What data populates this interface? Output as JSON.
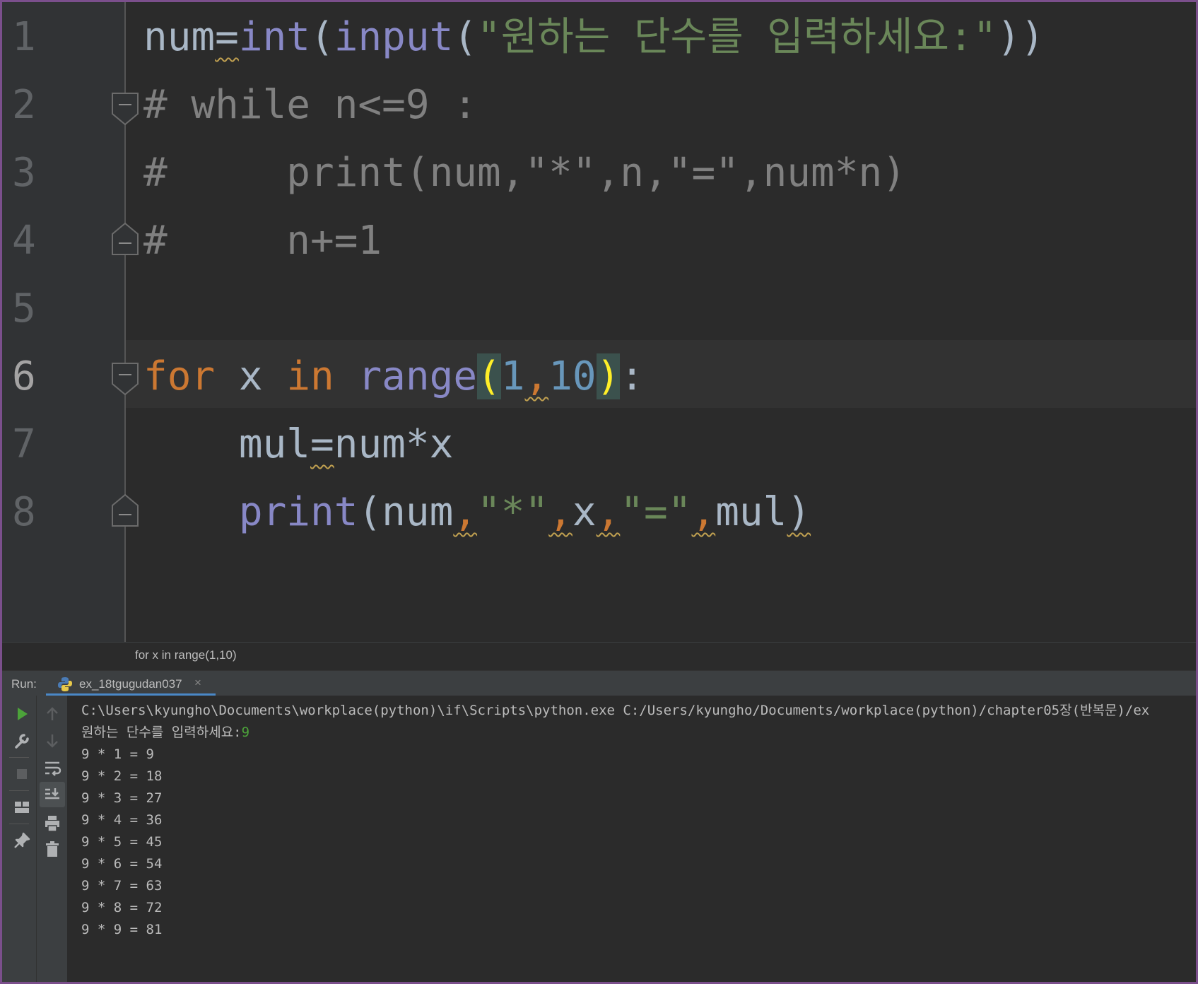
{
  "editor": {
    "line_numbers": [
      "1",
      "2",
      "3",
      "4",
      "5",
      "6",
      "7",
      "8"
    ],
    "line1": {
      "var": "num",
      "op": "=",
      "fn1": "int",
      "p1": "(",
      "fn2": "input",
      "p2": "(",
      "str": "\"원하는 단수를 입력하세요:\"",
      "p3": "))"
    },
    "line2": "# while n<=9 :",
    "line3": "#     print(num,\"*\",n,\"=\",num*n)",
    "line4": "#     n+=1",
    "line6": {
      "kw_for": "for",
      "var": " x ",
      "kw_in": "in",
      "sp": " ",
      "fn": "range",
      "open": "(",
      "a": "1",
      "comma": ",",
      "b": "10",
      "close": ")",
      "colon": ":"
    },
    "line7": {
      "indent": "    ",
      "var": "mul",
      "op": "=",
      "expr": "num*x"
    },
    "line8": {
      "indent": "    ",
      "fn": "print",
      "open": "(",
      "a": "num",
      "c1": ",",
      "s1": "\"*\"",
      "c2": ",",
      "x": "x",
      "c3": ",",
      "s2": "\"=\"",
      "c4": ",",
      "m": "mul",
      "close": ")"
    }
  },
  "breadcrumb": "for x in range(1,10)",
  "run_panel": {
    "label": "Run:",
    "tab_label": "ex_18tgugudan037",
    "tab_close": "×",
    "console": {
      "command": "C:\\Users\\kyungho\\Documents\\workplace(python)\\if\\Scripts\\python.exe C:/Users/kyungho/Documents/workplace(python)/chapter05장(반복문)/ex",
      "prompt": "원하는 단수를 입력하세요:",
      "user_input": "9",
      "outputs": [
        "9 * 1 = 9",
        "9 * 2 = 18",
        "9 * 3 = 27",
        "9 * 4 = 36",
        "9 * 5 = 45",
        "9 * 6 = 54",
        "9 * 7 = 63",
        "9 * 8 = 72",
        "9 * 9 = 81"
      ]
    }
  },
  "colors": {
    "keyword": "#cc7832",
    "builtin": "#8888c6",
    "string": "#6a8759",
    "number": "#6897bb",
    "comment": "#808080",
    "run_tab_accent": "#4a88c7",
    "run_green": "#4ca33a"
  },
  "icons": {
    "run": "play-icon",
    "rerun_tool": "wrench-icon",
    "stop": "stop-icon",
    "layout": "layout-icon",
    "pin": "pin-icon",
    "up": "arrow-up-icon",
    "down": "arrow-down-icon",
    "wrap": "soft-wrap-icon",
    "scroll_end": "scroll-to-end-icon",
    "print": "print-icon",
    "trash": "trash-icon",
    "python": "python-icon"
  }
}
